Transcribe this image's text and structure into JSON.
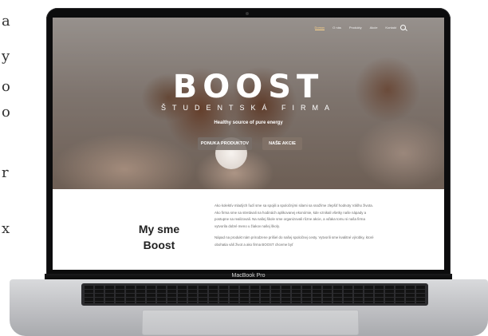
{
  "edge_letters": [
    "a",
    "y",
    "o",
    "o",
    "r",
    "x"
  ],
  "device": {
    "model": "MacBook Pro"
  },
  "site": {
    "nav": {
      "items": [
        "Domov",
        "O nás",
        "Produkty",
        "Akcie",
        "Kontakt"
      ],
      "active_index": 0
    },
    "hero": {
      "brand": "BOOST",
      "subtitle": "ŠTUDENTSKÁ FIRMA",
      "tagline": "Healthy source of pure energy",
      "button_products": "PONUKA PRODUKTOV",
      "button_events": "NAŠE AKCIE"
    },
    "about": {
      "title_line1": "My sme",
      "title_line2": "Boost",
      "paragraph1": "Ako kolektív mladých ľudí sme sa spojili a spoločnými silami sa snažíme zlepšiť hodnoty Vášho života. Ako firma sme sa stretávali na hodinách aplikovanej ekonómie, kde vznikali všetky naše nápady a postupne sa realizovali. Na našej škole sme organizovali rôzne akcie, a vďaka tomu si naša firma vytvorila dobré meno u žiakov našej školy.",
      "paragraph2": "Nápad na produkt nám prirodzene prišiel do našej spoločnej cesty. Vytvorili sme kvalitné výrobky, ktoré obohatia váš život a ako firma BOOST chceme byť"
    }
  }
}
